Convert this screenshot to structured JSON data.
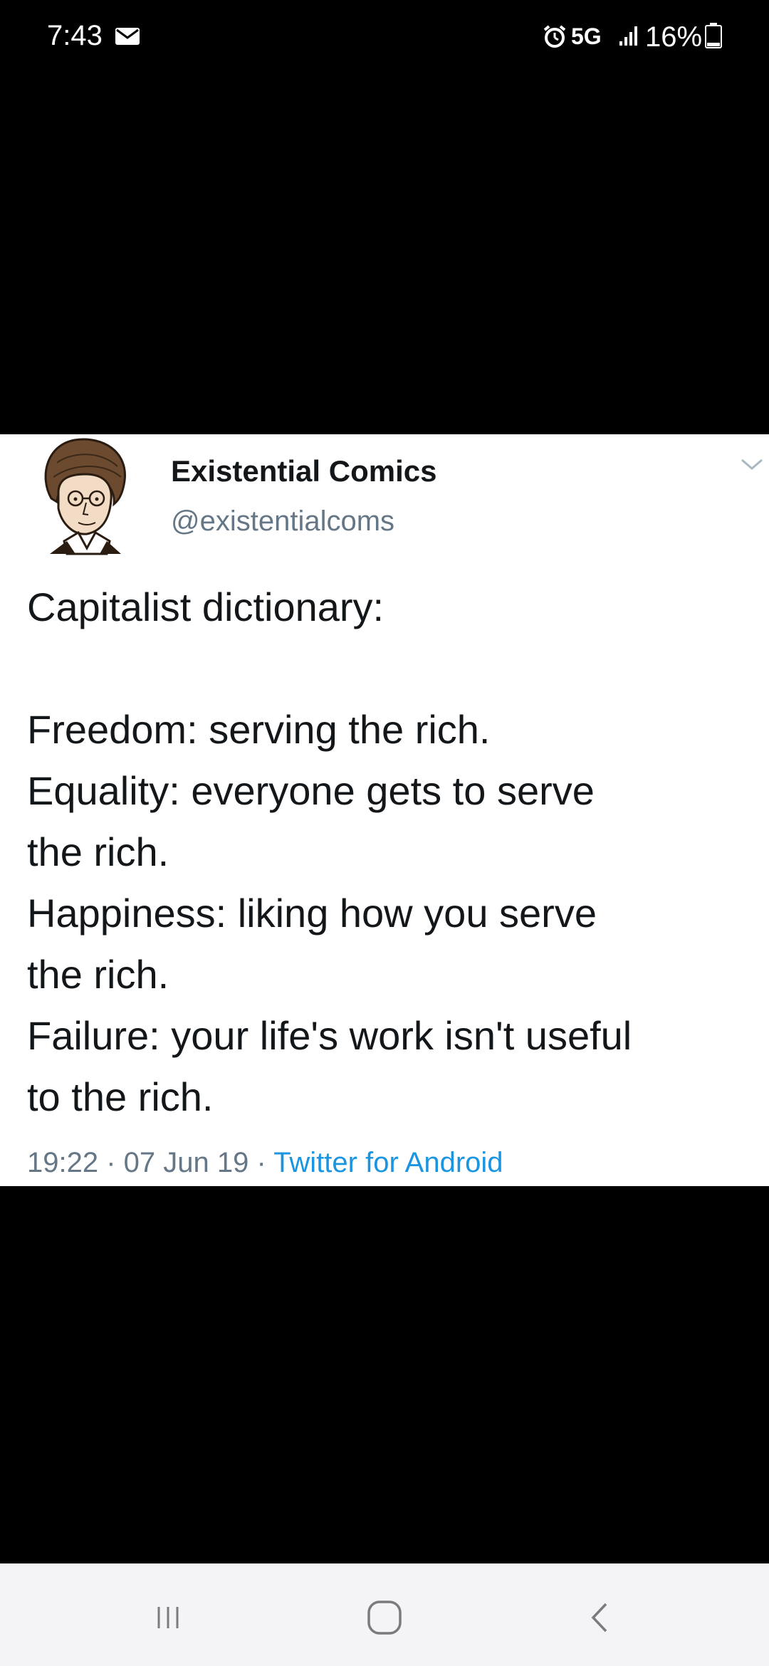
{
  "status_bar": {
    "time": "7:43",
    "network": "5G",
    "battery": "16%",
    "icons": [
      "mail-icon",
      "alarm-icon",
      "signal-icon",
      "battery-icon"
    ]
  },
  "tweet": {
    "display_name": "Existential Comics",
    "handle": "@existentialcoms",
    "lines": [
      "Capitalist dictionary:",
      "",
      "Freedom: serving the rich.",
      "Equality: everyone gets to serve",
      "the rich.",
      "Happiness: liking how you serve",
      "the rich.",
      "Failure: your life's work isn't useful",
      "to the rich."
    ],
    "time": "19:22",
    "date": "07 Jun 19",
    "separator": " · ",
    "source": "Twitter for Android",
    "icons": [
      "avatar",
      "caret-down-icon"
    ]
  },
  "nav_bar": {
    "icons": [
      "recent-apps-icon",
      "home-icon",
      "back-icon"
    ]
  },
  "colors": {
    "background": "#000000",
    "card": "#ffffff",
    "text": "#14171a",
    "secondary_text": "#657786",
    "link": "#1b95e0",
    "nav_bar": "#f4f4f6"
  }
}
